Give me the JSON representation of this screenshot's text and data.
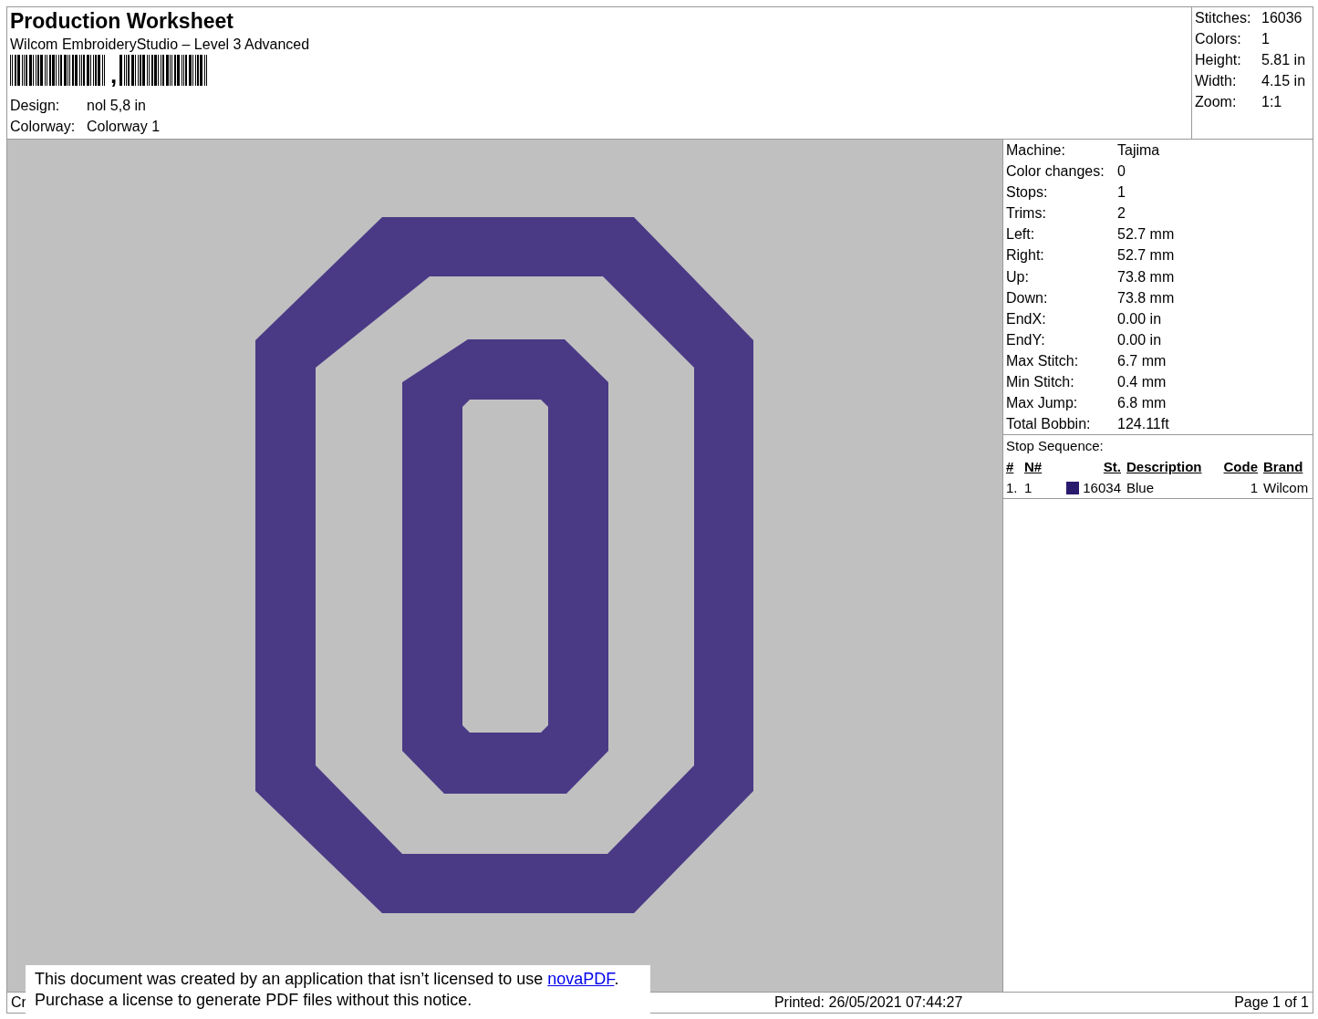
{
  "header": {
    "title": "Production Worksheet",
    "subtitle": "Wilcom EmbroideryStudio – Level 3 Advanced",
    "barcode_text": ",",
    "fields": [
      {
        "label": "Design:",
        "value": "nol 5,8 in"
      },
      {
        "label": "Colorway:",
        "value": "Colorway 1"
      }
    ]
  },
  "summary": [
    {
      "label": "Stitches:",
      "value": "16036"
    },
    {
      "label": "Colors:",
      "value": "1"
    },
    {
      "label": "Height:",
      "value": "5.81 in"
    },
    {
      "label": "Width:",
      "value": "4.15 in"
    },
    {
      "label": "Zoom:",
      "value": "1:1"
    }
  ],
  "details": [
    {
      "label": "Machine:",
      "value": "Tajima"
    },
    {
      "label": "Color changes:",
      "value": "0"
    },
    {
      "label": "Stops:",
      "value": "1"
    },
    {
      "label": "Trims:",
      "value": "2"
    },
    {
      "label": "Left:",
      "value": "52.7 mm"
    },
    {
      "label": "Right:",
      "value": "52.7 mm"
    },
    {
      "label": "Up:",
      "value": "73.8 mm"
    },
    {
      "label": "Down:",
      "value": "73.8 mm"
    },
    {
      "label": "EndX:",
      "value": "0.00 in"
    },
    {
      "label": "EndY:",
      "value": "0.00 in"
    },
    {
      "label": "Max Stitch:",
      "value": "6.7 mm"
    },
    {
      "label": "Min Stitch:",
      "value": "0.4 mm"
    },
    {
      "label": "Max Jump:",
      "value": "6.8 mm"
    },
    {
      "label": "Total Bobbin:",
      "value": "124.11ft"
    }
  ],
  "stop_sequence": {
    "title": "Stop Sequence:",
    "columns": [
      "#",
      "N#",
      "St.",
      "Description",
      "Code",
      "Brand"
    ],
    "rows": [
      {
        "index": "1.",
        "needle": "1",
        "color": "#2a1a6e",
        "stitches": "16034",
        "description": "Blue",
        "code": "1",
        "brand": "Wilcom"
      }
    ]
  },
  "footer": {
    "left": "Cr",
    "printed": "Printed: 26/05/2021 07:44:27",
    "page": "Page 1 of 1"
  },
  "notice": {
    "line_1": "This document was created by an application that isn’t licensed to use ",
    "link": "novaPDF",
    "line_1_end": ".",
    "line_2": "Purchase a license to generate PDF files without this notice."
  }
}
